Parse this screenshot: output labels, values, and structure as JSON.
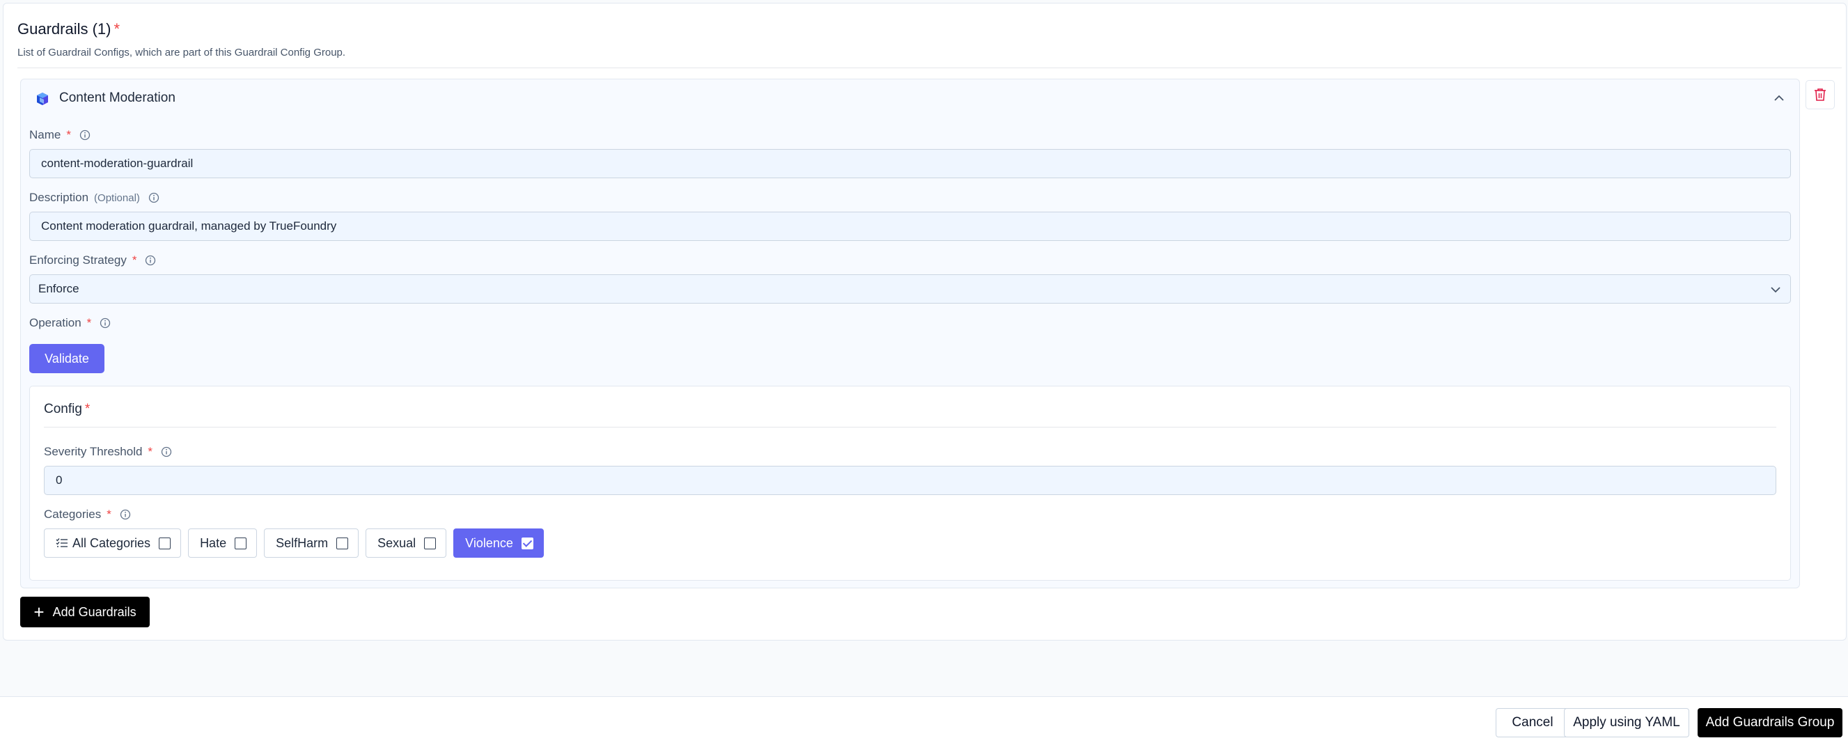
{
  "section": {
    "title": "Guardrails (1)",
    "required_mark": "*",
    "subtitle": "List of Guardrail Configs, which are part of this Guardrail Config Group."
  },
  "guardrail": {
    "title": "Content Moderation",
    "fields": {
      "name": {
        "label": "Name",
        "value": "content-moderation-guardrail"
      },
      "description": {
        "label": "Description",
        "optional": "(Optional)",
        "value": "Content moderation guardrail, managed by TrueFoundry"
      },
      "enforcing_strategy": {
        "label": "Enforcing Strategy",
        "value": "Enforce"
      },
      "operation": {
        "label": "Operation",
        "button": "Validate"
      }
    },
    "config": {
      "title": "Config",
      "severity_threshold": {
        "label": "Severity Threshold",
        "value": "0"
      },
      "categories": {
        "label": "Categories",
        "options": [
          {
            "label": "All Categories",
            "checked": false
          },
          {
            "label": "Hate",
            "checked": false
          },
          {
            "label": "SelfHarm",
            "checked": false
          },
          {
            "label": "Sexual",
            "checked": false
          },
          {
            "label": "Violence",
            "checked": true
          }
        ]
      }
    }
  },
  "add_guardrails_label": "Add Guardrails",
  "footer": {
    "cancel": "Cancel",
    "apply_yaml": "Apply using YAML",
    "submit": "Add Guardrails Group"
  },
  "colors": {
    "accent": "#6366f1",
    "required": "#ef4444",
    "input_bg": "#eff6ff"
  },
  "icons": {
    "header": "content-moderation-logo-icon",
    "collapse": "chevron-up-icon",
    "info": "info-icon",
    "delete": "trash-icon",
    "add": "plus-icon",
    "select": "chevron-down-icon",
    "all_categories": "list-check-icon"
  }
}
